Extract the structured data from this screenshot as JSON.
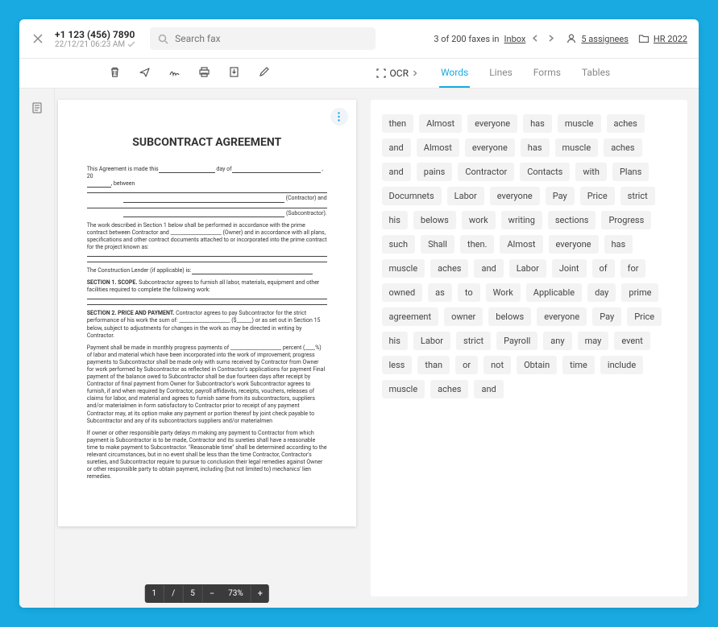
{
  "header": {
    "phone": "+1 123 (456) 7890",
    "date": "22/12/21 06:23 AM",
    "search_placeholder": "Search fax",
    "pager_prefix": "3 of 200 faxes in ",
    "pager_location": "Inbox",
    "assignees": "5 assignees",
    "folder": "HR 2022"
  },
  "ocr_label": "OCR",
  "tabs": [
    "Words",
    "Lines",
    "Forms",
    "Tables"
  ],
  "page_controls": {
    "page": "1",
    "sep": "/",
    "total": "5",
    "zoom": "73%"
  },
  "doc": {
    "title": "SUBCONTRACT AGREEMENT",
    "line1_a": "This Agreement is made this",
    "line1_b": "day of",
    "line1_c": ", 20",
    "line2": ", between",
    "line3": "(Contractor) and",
    "line4": "(Subcontractor).",
    "para1": "The work described in Section 1 below shall be performed in accordance with the prime contract between Contractor and ____________________ (Owner) and in accordance with all plans, specifications and other contract documents attached to or incorporated into the prime contract for the project known as:",
    "lender": "The Construction Lender (if applicable) is:",
    "s1_head": "SECTION 1. SCOPE.",
    "s1_text": " Subcontractor agrees to furnish all labor, materials, equipment and other facilities required to complete the following work:",
    "s2_head": "SECTION 2. PRICE AND PAYMENT.",
    "s2_text": " Contractor agrees to pay Subcontractor for the strict performance of his work the sum of: ____________________ ($______) or as set out in Section 15 below, subject to adjustments for changes in the work as may be directed in writing by Contractor.",
    "s2_pay": "Payment shall be made in monthly progress payments of ____________________ percent (____%) of labor and material which have been incorporated into the work of improvement; progress payments to Subcontractor shall be made only with sums received by Contractor from Owner for work performed by Subcontractor as reflected in Contractor's applications for payment Final payment of the balance owed to Subcontractor shall be due fourteen days after receipt by Contractor of final payment from Owner for Subcontractor's work Subcontractor agrees to furnish, if and when required by Contractor, payroll affidavits, receipts, vouchers, releases of claims for labor, and material and agrees to furnish same from its subcontractors, suppliers and/or materialmen in form satisfactory to Contractor prior to receipt of any payment Contractor may, at its option make any payment or portion thereof by joint check payable to Subcontractor and any of its subcontractors suppliers and/or materialmen",
    "s2_delay": "If owner or other responsible party delays m making any payment to Contractor from which payment is Subcontractor is to be made, Contractor and its sureties shall have a reasonable time to make payment to Subcontractor. \"Reasonable time\" shall be determined according to the relevant circumstances, but in no event shall be less than the time Contractor, Contractor's sureties, and Subcontractor require to pursue to conclusion their legal remedies against Owner or other responsible party to obtain payment, including (but not limited to) mechanics' lien remedies."
  },
  "words": [
    "then",
    "Almost",
    "everyone",
    "has",
    "muscle",
    "aches",
    "and",
    "Almost",
    "everyone",
    "has",
    "muscle",
    "aches",
    "and",
    "pains",
    "Contractor",
    "Contacts",
    "with",
    "Plans",
    "Documnets",
    "Labor",
    "everyone",
    "Pay",
    "Price",
    "strict",
    "his",
    "belows",
    "work",
    "writing",
    "sections",
    "Progress",
    "such",
    "Shall",
    "then.",
    "Almost",
    "everyone",
    "has",
    "muscle",
    "aches",
    "and",
    "Labor",
    "Joint",
    "of",
    "for",
    "owned",
    "as",
    "to",
    "Work",
    "Applicable",
    "day",
    "prime",
    "agreement",
    "owner",
    "belows",
    "everyone",
    "Pay",
    "Price",
    "his",
    "Labor",
    "strict",
    "Payroll",
    "any",
    "may",
    "event",
    "less",
    "than",
    "or",
    "not",
    "Obtain",
    "time",
    "include",
    "muscle",
    "aches",
    "and"
  ]
}
